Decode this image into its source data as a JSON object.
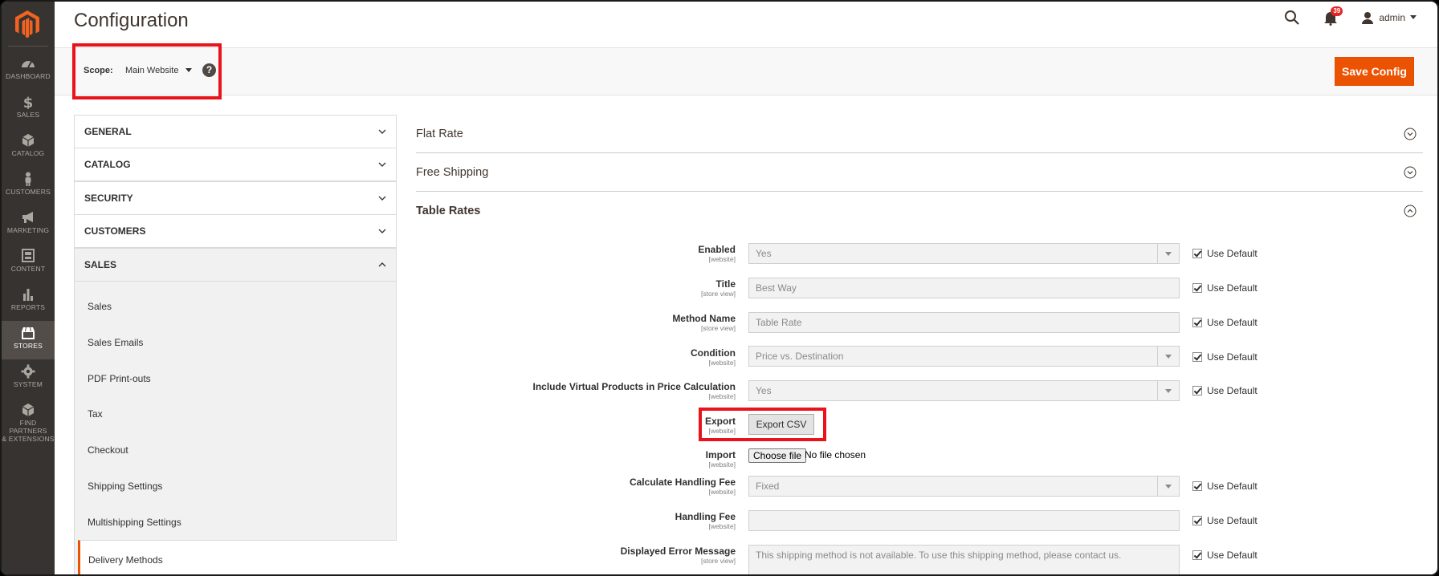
{
  "page_title": "Configuration",
  "nav": [
    {
      "label": "DASHBOARD",
      "icon": "dashboard-icon"
    },
    {
      "label": "SALES",
      "icon": "dollar-icon"
    },
    {
      "label": "CATALOG",
      "icon": "box-icon"
    },
    {
      "label": "CUSTOMERS",
      "icon": "person-icon"
    },
    {
      "label": "MARKETING",
      "icon": "megaphone-icon"
    },
    {
      "label": "CONTENT",
      "icon": "layout-icon"
    },
    {
      "label": "REPORTS",
      "icon": "bar-chart-icon"
    },
    {
      "label": "STORES",
      "icon": "store-icon"
    },
    {
      "label": "SYSTEM",
      "icon": "gear-icon"
    },
    {
      "label1": "FIND PARTNERS",
      "label2": "& EXTENSIONS",
      "icon": "extensions-icon"
    }
  ],
  "header": {
    "notifications_count": "39",
    "user": "admin"
  },
  "scope": {
    "label": "Scope:",
    "value": "Main Website",
    "help": "?"
  },
  "save_label": "Save Config",
  "tabs": {
    "general": "GENERAL",
    "catalog": "CATALOG",
    "security": "SECURITY",
    "customers": "CUSTOMERS",
    "sales": "SALES",
    "sales_items": [
      "Sales",
      "Sales Emails",
      "PDF Print-outs",
      "Tax",
      "Checkout",
      "Shipping Settings",
      "Multishipping Settings"
    ],
    "active_item": "Delivery Methods"
  },
  "sections": {
    "flat_rate": "Flat Rate",
    "free_shipping": "Free Shipping",
    "table_rates": "Table Rates"
  },
  "form": {
    "use_default": "Use Default",
    "rows": [
      {
        "label": "Enabled",
        "scope": "[website]",
        "value": "Yes"
      },
      {
        "label": "Title",
        "scope": "[store view]",
        "value": "Best Way"
      },
      {
        "label": "Method Name",
        "scope": "[store view]",
        "value": "Table Rate"
      },
      {
        "label": "Condition",
        "scope": "[website]",
        "value": "Price vs. Destination"
      },
      {
        "label": "Include Virtual Products in Price Calculation",
        "scope": "[website]",
        "value": "Yes"
      },
      {
        "label": "Export",
        "scope": "[website]",
        "button": "Export CSV"
      },
      {
        "label": "Import",
        "scope": "[website]",
        "file_button": "Choose file",
        "file_text": "No file chosen"
      },
      {
        "label": "Calculate Handling Fee",
        "scope": "[website]",
        "value": "Fixed"
      },
      {
        "label": "Handling Fee",
        "scope": "[website]",
        "value": ""
      },
      {
        "label": "Displayed Error Message",
        "scope": "[store view]",
        "value": "This shipping method is not available. To use this shipping method, please contact us."
      }
    ]
  }
}
